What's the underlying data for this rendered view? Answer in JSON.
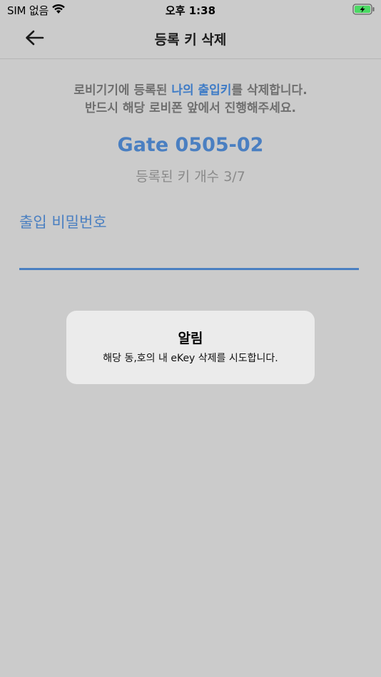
{
  "status_bar": {
    "carrier": "SIM 없음",
    "time": "오후 1:38",
    "icons": [
      "wifi-icon",
      "battery-charging-icon"
    ]
  },
  "nav": {
    "title": "등록 키 삭제",
    "back_icon": "arrow-left-icon"
  },
  "description": {
    "line1_prefix": "로비기기에 등록된 ",
    "line1_highlight": "나의 출입키",
    "line1_suffix": "를 삭제합니다.",
    "line2": "반드시 해당 로비폰 앞에서 진행해주세요."
  },
  "gate": {
    "name": "Gate 0505-02",
    "key_count": "등록된 키 개수 3/7"
  },
  "password": {
    "label": "출입 비밀번호",
    "value": ""
  },
  "alert": {
    "title": "알림",
    "message": "해당 동,호의 내 eKey 삭제를 시도합니다."
  },
  "colors": {
    "background": "#cbcbcb",
    "accent": "#4a7fc1",
    "alert_bg": "#ebebeb",
    "battery": "#4cd964"
  }
}
